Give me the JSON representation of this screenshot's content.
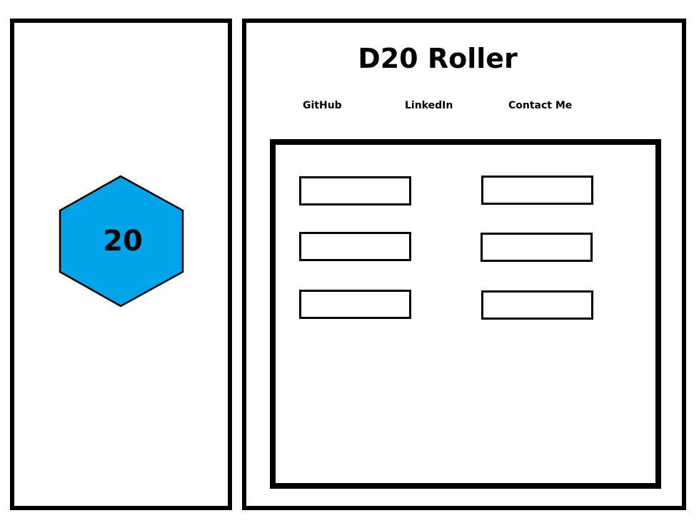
{
  "die": {
    "value": "20",
    "color": "#00a2e8",
    "shape": "hexagon"
  },
  "header": {
    "title": "D20 Roller"
  },
  "nav": {
    "items": [
      {
        "label": "GitHub"
      },
      {
        "label": "LinkedIn"
      },
      {
        "label": "Contact Me"
      }
    ]
  },
  "content": {
    "slots": [
      {
        "value": ""
      },
      {
        "value": ""
      },
      {
        "value": ""
      },
      {
        "value": ""
      },
      {
        "value": ""
      },
      {
        "value": ""
      }
    ]
  }
}
